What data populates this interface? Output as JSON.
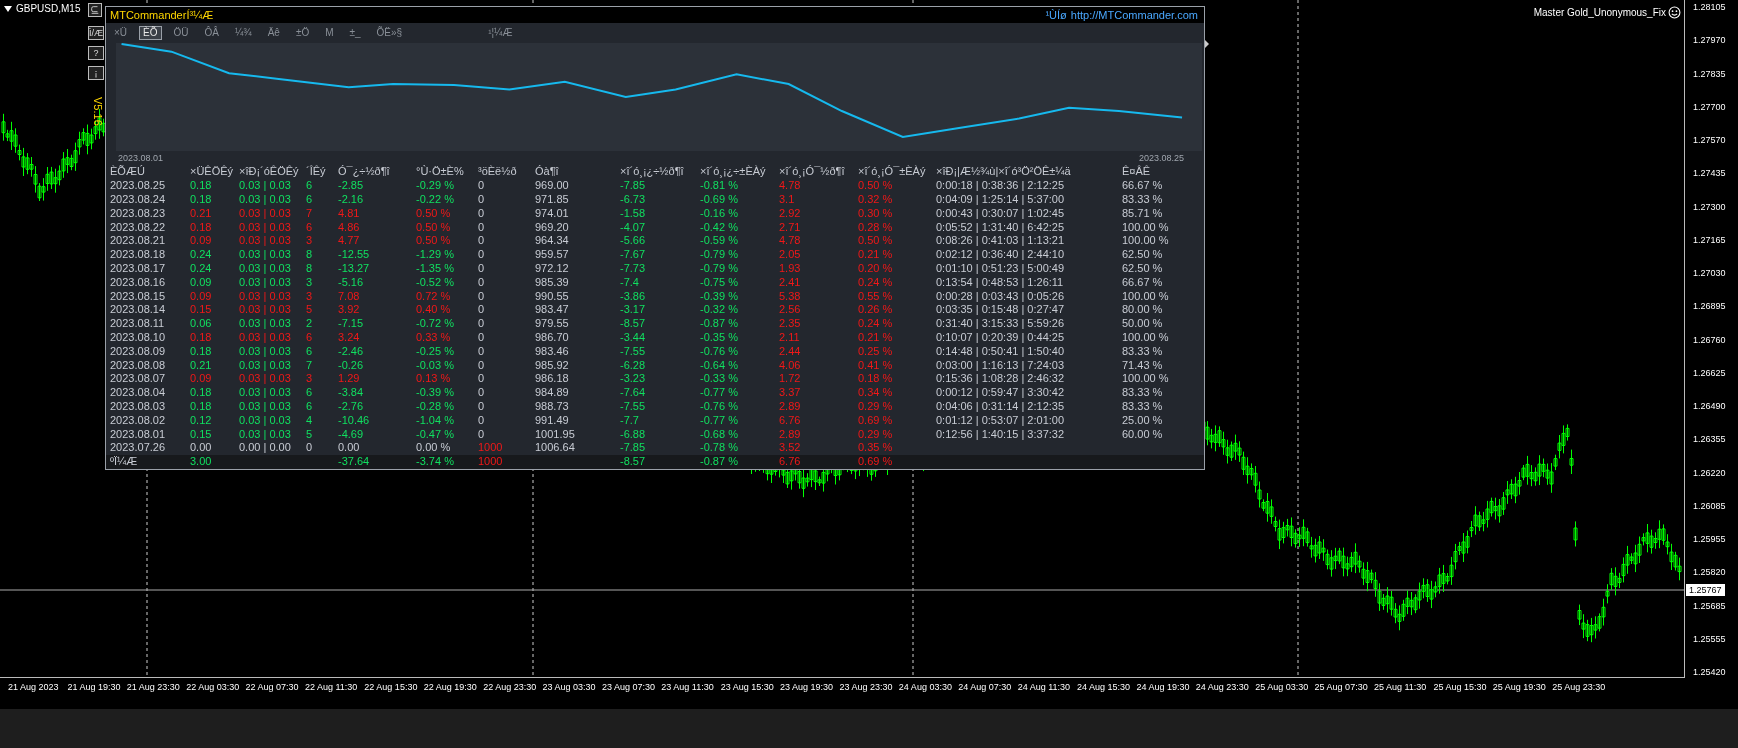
{
  "chart_window": {
    "symbol": "GBPUSD,M15",
    "side_buttons": [
      "Ì/Æ",
      "?",
      "¡"
    ],
    "version": "V5.16",
    "expert": "Master Gold_Unonymous_Fix",
    "price_axis": [
      "1.28105",
      "1.27970",
      "1.27835",
      "1.27700",
      "1.27570",
      "1.27435",
      "1.27300",
      "1.27165",
      "1.27030",
      "1.26895",
      "1.26760",
      "1.26625",
      "1.26490",
      "1.26355",
      "1.26220",
      "1.26085",
      "1.25955",
      "1.25820",
      "1.25685",
      "1.25555",
      "1.25420"
    ],
    "current_price": "1.25767",
    "time_axis": [
      "21 Aug 2023",
      "21 Aug 19:30",
      "21 Aug 23:30",
      "22 Aug 03:30",
      "22 Aug 07:30",
      "22 Aug 11:30",
      "22 Aug 15:30",
      "22 Aug 19:30",
      "22 Aug 23:30",
      "23 Aug 03:30",
      "23 Aug 07:30",
      "23 Aug 11:30",
      "23 Aug 15:30",
      "23 Aug 19:30",
      "23 Aug 23:30",
      "24 Aug 03:30",
      "24 Aug 07:30",
      "24 Aug 11:30",
      "24 Aug 15:30",
      "24 Aug 19:30",
      "24 Aug 23:30",
      "25 Aug 03:30",
      "25 Aug 07:30",
      "25 Aug 11:30",
      "25 Aug 15:30",
      "25 Aug 19:30",
      "25 Aug 23:30"
    ]
  },
  "panel": {
    "title": "MTCommanderÍ³¼Æ",
    "link_label": "¹ÙÍø",
    "link": "http://MTCommander.com",
    "tabs": [
      {
        "label": "×Ü",
        "selected": false
      },
      {
        "label": "ÈÕ",
        "selected": true
      },
      {
        "label": "ÖÜ",
        "selected": false
      },
      {
        "label": "ÔÂ",
        "selected": false
      },
      {
        "label": "¼¾",
        "selected": false
      },
      {
        "label": "Äê",
        "selected": false
      },
      {
        "label": "±Ö",
        "selected": false
      },
      {
        "label": "M",
        "selected": false
      },
      {
        "label": "±_",
        "selected": false
      },
      {
        "label": "ÕË»§",
        "selected": false
      },
      {
        "label": "¹¦¼Æ",
        "selected": false
      }
    ],
    "equity": {
      "start_label": "2023.08.01",
      "end_label": "2023.08.25"
    },
    "table": {
      "columns": [
        {
          "label": "ÈÕÆÚ",
          "kind": "plain"
        },
        {
          "label": "×ÜÊÖÊý",
          "kind": "row"
        },
        {
          "label": "×îÐ¡´óÊÖÊý",
          "kind": "row"
        },
        {
          "label": "´ÎÊý",
          "kind": "row"
        },
        {
          "label": "Ó¯¿÷½ð¶î",
          "kind": "row"
        },
        {
          "label": "°Ù·Ö±È%",
          "kind": "row"
        },
        {
          "label": "³öÈë½ð",
          "kind": "flow"
        },
        {
          "label": "Óà¶î",
          "kind": "plain"
        },
        {
          "label": "×î´ó¸¡¿÷½ð¶î",
          "kind": "green"
        },
        {
          "label": "×î´ó¸¡¿÷±ÈÀý",
          "kind": "green"
        },
        {
          "label": "×î´ó¸¡Ó¯½ð¶î",
          "kind": "red"
        },
        {
          "label": "×î´ó¸¡Ó¯±ÈÀý",
          "kind": "red"
        },
        {
          "label": "×îÐ¡|Æ½¾ù|×î´ó³Ö²ÖÊ±¼ä",
          "kind": "plain"
        },
        {
          "label": "Ê¤ÂÊ",
          "kind": "plain"
        }
      ],
      "rows": [
        {
          "kind": "green",
          "flow_marked": false,
          "cells": [
            "2023.08.25",
            "0.18",
            "0.03 | 0.03",
            "6",
            "-2.85",
            "-0.29 %",
            "0",
            "969.00",
            "-7.85",
            "-0.81 %",
            "4.78",
            "0.50 %",
            "0:00:18 | 0:38:36 | 2:12:25",
            "66.67 %"
          ]
        },
        {
          "kind": "green",
          "flow_marked": false,
          "cells": [
            "2023.08.24",
            "0.18",
            "0.03 | 0.03",
            "6",
            "-2.16",
            "-0.22 %",
            "0",
            "971.85",
            "-6.73",
            "-0.69 %",
            "3.1",
            "0.32 %",
            "0:04:09 | 1:25:14 | 5:37:00",
            "83.33 %"
          ]
        },
        {
          "kind": "red",
          "flow_marked": false,
          "cells": [
            "2023.08.23",
            "0.21",
            "0.03 | 0.03",
            "7",
            "4.81",
            "0.50 %",
            "0",
            "974.01",
            "-1.58",
            "-0.16 %",
            "2.92",
            "0.30 %",
            "0:00:43 | 0:30:07 | 1:02:45",
            "85.71 %"
          ]
        },
        {
          "kind": "red",
          "flow_marked": false,
          "cells": [
            "2023.08.22",
            "0.18",
            "0.03 | 0.03",
            "6",
            "4.86",
            "0.50 %",
            "0",
            "969.20",
            "-4.07",
            "-0.42 %",
            "2.71",
            "0.28 %",
            "0:05:52 | 1:31:40 | 6:42:25",
            "100.00 %"
          ]
        },
        {
          "kind": "red",
          "flow_marked": false,
          "cells": [
            "2023.08.21",
            "0.09",
            "0.03 | 0.03",
            "3",
            "4.77",
            "0.50 %",
            "0",
            "964.34",
            "-5.66",
            "-0.59 %",
            "4.78",
            "0.50 %",
            "0:08:26 | 0:41:03 | 1:13:21",
            "100.00 %"
          ]
        },
        {
          "kind": "green",
          "flow_marked": false,
          "cells": [
            "2023.08.18",
            "0.24",
            "0.03 | 0.03",
            "8",
            "-12.55",
            "-1.29 %",
            "0",
            "959.57",
            "-7.67",
            "-0.79 %",
            "2.05",
            "0.21 %",
            "0:02:12 | 0:36:40 | 2:44:10",
            "62.50 %"
          ]
        },
        {
          "kind": "green",
          "flow_marked": false,
          "cells": [
            "2023.08.17",
            "0.24",
            "0.03 | 0.03",
            "8",
            "-13.27",
            "-1.35 %",
            "0",
            "972.12",
            "-7.73",
            "-0.79 %",
            "1.93",
            "0.20 %",
            "0:01:10 | 0:51:23 | 5:00:49",
            "62.50 %"
          ]
        },
        {
          "kind": "green",
          "flow_marked": false,
          "cells": [
            "2023.08.16",
            "0.09",
            "0.03 | 0.03",
            "3",
            "-5.16",
            "-0.52 %",
            "0",
            "985.39",
            "-7.4",
            "-0.75 %",
            "2.41",
            "0.24 %",
            "0:13:54 | 0:48:53 | 1:26:11",
            "66.67 %"
          ]
        },
        {
          "kind": "red",
          "flow_marked": false,
          "cells": [
            "2023.08.15",
            "0.09",
            "0.03 | 0.03",
            "3",
            "7.08",
            "0.72 %",
            "0",
            "990.55",
            "-3.86",
            "-0.39 %",
            "5.38",
            "0.55 %",
            "0:00:28 | 0:03:43 | 0:05:26",
            "100.00 %"
          ]
        },
        {
          "kind": "red",
          "flow_marked": false,
          "cells": [
            "2023.08.14",
            "0.15",
            "0.03 | 0.03",
            "5",
            "3.92",
            "0.40 %",
            "0",
            "983.47",
            "-3.17",
            "-0.32 %",
            "2.56",
            "0.26 %",
            "0:03:35 | 0:15:48 | 0:27:47",
            "80.00 %"
          ]
        },
        {
          "kind": "green",
          "flow_marked": false,
          "cells": [
            "2023.08.11",
            "0.06",
            "0.03 | 0.03",
            "2",
            "-7.15",
            "-0.72 %",
            "0",
            "979.55",
            "-8.57",
            "-0.87 %",
            "2.35",
            "0.24 %",
            "0:31:40 | 3:15:33 | 5:59:26",
            "50.00 %"
          ]
        },
        {
          "kind": "red",
          "flow_marked": false,
          "cells": [
            "2023.08.10",
            "0.18",
            "0.03 | 0.03",
            "6",
            "3.24",
            "0.33 %",
            "0",
            "986.70",
            "-3.44",
            "-0.35 %",
            "2.11",
            "0.21 %",
            "0:10:07 | 0:20:39 | 0:44:25",
            "100.00 %"
          ]
        },
        {
          "kind": "green",
          "flow_marked": false,
          "cells": [
            "2023.08.09",
            "0.18",
            "0.03 | 0.03",
            "6",
            "-2.46",
            "-0.25 %",
            "0",
            "983.46",
            "-7.55",
            "-0.76 %",
            "2.44",
            "0.25 %",
            "0:14:48 | 0:50:41 | 1:50:40",
            "83.33 %"
          ]
        },
        {
          "kind": "green",
          "flow_marked": false,
          "cells": [
            "2023.08.08",
            "0.21",
            "0.03 | 0.03",
            "7",
            "-0.26",
            "-0.03 %",
            "0",
            "985.92",
            "-6.28",
            "-0.64 %",
            "4.06",
            "0.41 %",
            "0:03:00 | 1:16:13 | 7:24:03",
            "71.43 %"
          ]
        },
        {
          "kind": "red",
          "flow_marked": false,
          "cells": [
            "2023.08.07",
            "0.09",
            "0.03 | 0.03",
            "3",
            "1.29",
            "0.13 %",
            "0",
            "986.18",
            "-3.23",
            "-0.33 %",
            "1.72",
            "0.18 %",
            "0:15:36 | 1:08:28 | 2:46:32",
            "100.00 %"
          ]
        },
        {
          "kind": "green",
          "flow_marked": false,
          "cells": [
            "2023.08.04",
            "0.18",
            "0.03 | 0.03",
            "6",
            "-3.84",
            "-0.39 %",
            "0",
            "984.89",
            "-7.64",
            "-0.77 %",
            "3.37",
            "0.34 %",
            "0:00:12 | 0:59:47 | 3:30:42",
            "83.33 %"
          ]
        },
        {
          "kind": "green",
          "flow_marked": false,
          "cells": [
            "2023.08.03",
            "0.18",
            "0.03 | 0.03",
            "6",
            "-2.76",
            "-0.28 %",
            "0",
            "988.73",
            "-7.55",
            "-0.76 %",
            "2.89",
            "0.29 %",
            "0:04:06 | 0:31:14 | 2:12:35",
            "83.33 %"
          ]
        },
        {
          "kind": "green",
          "flow_marked": false,
          "cells": [
            "2023.08.02",
            "0.12",
            "0.03 | 0.03",
            "4",
            "-10.46",
            "-1.04 %",
            "0",
            "991.49",
            "-7.7",
            "-0.77 %",
            "6.76",
            "0.69 %",
            "0:01:12 | 0:53:07 | 2:01:00",
            "25.00 %"
          ]
        },
        {
          "kind": "green",
          "flow_marked": false,
          "cells": [
            "2023.08.01",
            "0.15",
            "0.03 | 0.03",
            "5",
            "-4.69",
            "-0.47 %",
            "0",
            "1001.95",
            "-6.88",
            "-0.68 %",
            "2.89",
            "0.29 %",
            "0:12:56 | 1:40:15 | 3:37:32",
            "60.00 %"
          ]
        },
        {
          "kind": "flat",
          "flow_marked": true,
          "cells": [
            "2023.07.26",
            "0.00",
            "0.00 | 0.00",
            "0",
            "0.00",
            "0.00 %",
            "1000",
            "1006.64",
            "-7.85",
            "-0.78 %",
            "3.52",
            "0.35 %",
            null,
            null
          ]
        }
      ],
      "total": {
        "kind": "green",
        "flow_marked": true,
        "cells": [
          "ºÏ¼Æ",
          "3.00",
          null,
          null,
          "-37.64",
          "-3.74 %",
          "1000",
          null,
          "-8.57",
          "-0.87 %",
          "6.76",
          "0.69 %",
          null,
          null
        ]
      }
    }
  }
}
